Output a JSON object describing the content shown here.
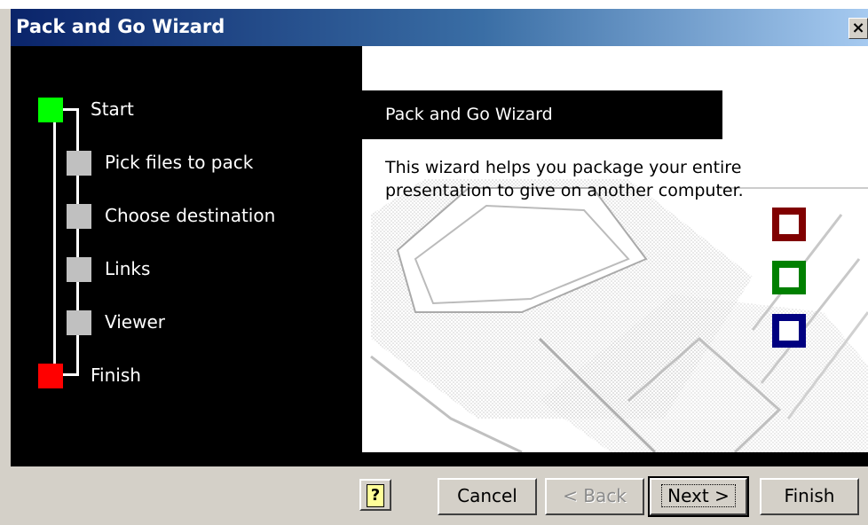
{
  "window": {
    "title": "Pack and Go Wizard",
    "close_symbol": "×"
  },
  "steps": [
    {
      "label": "Start",
      "state": "current",
      "color": "#00ff00"
    },
    {
      "label": "Pick files to pack",
      "state": "pending",
      "color": "#c0c0c0"
    },
    {
      "label": "Choose destination",
      "state": "pending",
      "color": "#c0c0c0"
    },
    {
      "label": "Links",
      "state": "pending",
      "color": "#c0c0c0"
    },
    {
      "label": "Viewer",
      "state": "pending",
      "color": "#c0c0c0"
    },
    {
      "label": "Finish",
      "state": "end",
      "color": "#ff0000"
    }
  ],
  "content": {
    "heading": "Pack and Go Wizard",
    "description": "This wizard helps you package your entire presentation to give on another computer."
  },
  "decor": {
    "square_colors": [
      "#800000",
      "#008000",
      "#000080"
    ]
  },
  "buttons": {
    "help": "?",
    "cancel": "Cancel",
    "back": "< Back",
    "next": "Next >",
    "finish": "Finish"
  }
}
